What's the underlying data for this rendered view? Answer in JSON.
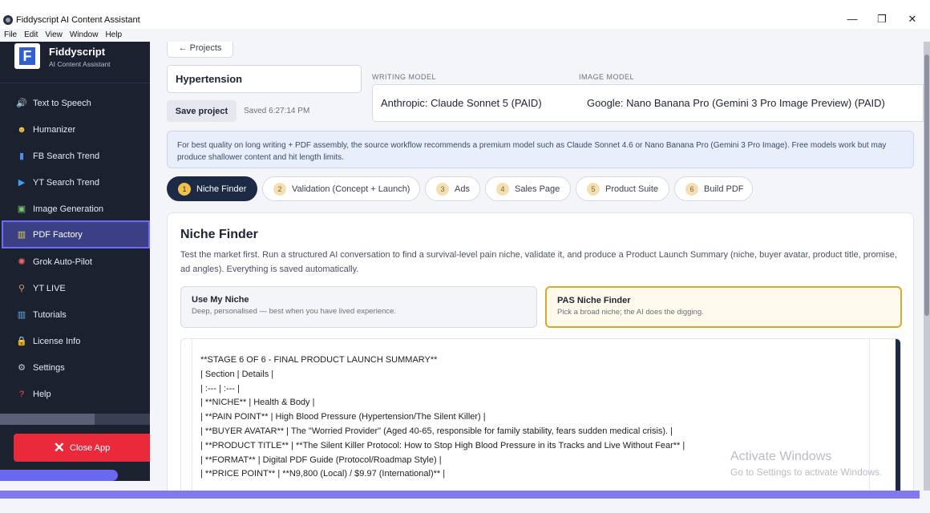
{
  "window": {
    "title": "Fiddyscript AI Content Assistant",
    "menu": [
      "File",
      "Edit",
      "View",
      "Window",
      "Help"
    ],
    "controls": {
      "minimize": "—",
      "maximize": "❐",
      "close": "✕"
    }
  },
  "sidebar": {
    "brand": {
      "name": "Fiddyscript",
      "subtitle": "AI Content Assistant",
      "logo_letter": "F"
    },
    "items": [
      {
        "label": "Text to Speech",
        "icon": "speaker-icon",
        "glyph": "🔊",
        "color": "#d9dce6"
      },
      {
        "label": "Humanizer",
        "icon": "mask-icon",
        "glyph": "☻",
        "color": "#f2c14e"
      },
      {
        "label": "FB Search Trend",
        "icon": "bar-chart-icon",
        "glyph": "▮",
        "color": "#4d8df0"
      },
      {
        "label": "YT Search Trend",
        "icon": "play-icon",
        "glyph": "▶",
        "color": "#3aa0f0"
      },
      {
        "label": "Image Generation",
        "icon": "image-icon",
        "glyph": "▣",
        "color": "#7cc36a"
      },
      {
        "label": "PDF Factory",
        "icon": "building-icon",
        "glyph": "▥",
        "color": "#e8d14a"
      },
      {
        "label": "Grok Auto-Pilot",
        "icon": "gear-palette-icon",
        "glyph": "✺",
        "color": "#f06a6a"
      },
      {
        "label": "YT LIVE",
        "icon": "broom-icon",
        "glyph": "⚲",
        "color": "#d0a060"
      },
      {
        "label": "Tutorials",
        "icon": "books-icon",
        "glyph": "▥",
        "color": "#5ab0e8"
      },
      {
        "label": "License Info",
        "icon": "lock-icon",
        "glyph": "🔒",
        "color": "#f2c14e"
      },
      {
        "label": "Settings",
        "icon": "gear-icon",
        "glyph": "⚙",
        "color": "#c9ccd6"
      },
      {
        "label": "Help",
        "icon": "question-icon",
        "glyph": "?",
        "color": "#ff4d4d"
      }
    ],
    "active_index": 5,
    "close_label": "Close App"
  },
  "main": {
    "back_label": "← Projects",
    "project_name": "Hypertension",
    "save_label": "Save project",
    "saved_at": "Saved 6:27:14 PM",
    "writing_model": {
      "label": "WRITING MODEL",
      "value": "Anthropic: Claude Sonnet 5 (PAID)"
    },
    "image_model": {
      "label": "IMAGE MODEL",
      "value": "Google: Nano Banana Pro (Gemini 3 Pro Image Preview) (PAID)"
    },
    "info": "For best quality on long writing + PDF assembly, the source workflow recommends a premium model such as Claude Sonnet 4.6 or Nano Banana Pro (Gemini 3 Pro Image). Free models work but may produce shallower content and hit length limits.",
    "steps": [
      {
        "num": "1",
        "label": "Niche Finder"
      },
      {
        "num": "2",
        "label": "Validation (Concept + Launch)"
      },
      {
        "num": "3",
        "label": "Ads"
      },
      {
        "num": "4",
        "label": "Sales Page"
      },
      {
        "num": "5",
        "label": "Product Suite"
      },
      {
        "num": "6",
        "label": "Build PDF"
      }
    ],
    "active_step": 0,
    "card": {
      "title": "Niche Finder",
      "description": "Test the market first. Run a structured AI conversation to find a survival-level pain niche, validate it, and produce a Product Launch Summary (niche, buyer avatar, product title, promise, ad angles). Everything is saved automatically.",
      "modes": [
        {
          "title": "Use My Niche",
          "subtitle": "Deep, personalised — best when you have lived experience."
        },
        {
          "title": "PAS Niche Finder",
          "subtitle": "Pick a broad niche; the AI does the digging."
        }
      ],
      "selected_mode": 1,
      "transcript": [
        "**STAGE 6 OF 6 - FINAL PRODUCT LAUNCH SUMMARY**",
        "",
        "| Section | Details |",
        "| :--- | :--- |",
        "| **NICHE** | Health & Body |",
        "| **PAIN POINT** | High Blood Pressure (Hypertension/The Silent Killer) |",
        "| **BUYER AVATAR** | The \"Worried Provider\" (Aged 40-65, responsible for family stability, fears sudden medical crisis). |",
        "| **PRODUCT TITLE** | **The Silent Killer Protocol: How to Stop High Blood Pressure in its Tracks and Live Without Fear** |",
        "| **FORMAT** | Digital PDF Guide (Protocol/Roadmap Style) |",
        "| **PRICE POINT** | **N9,800 (Local) / $9.97 (International)** |"
      ]
    }
  },
  "watermark": {
    "line1": "Activate Windows",
    "line2": "Go to Settings to activate Windows."
  }
}
